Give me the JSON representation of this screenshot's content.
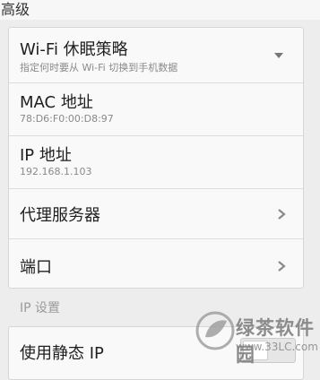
{
  "header": {
    "title": "高级"
  },
  "advanced": {
    "wifi_sleep": {
      "label": "Wi-Fi 休眠策略",
      "summary": "指定何时要从 Wi-Fi 切换到手机数据"
    },
    "mac": {
      "label": "MAC 地址",
      "value": "78:D6:F0:00:D8:97"
    },
    "ip": {
      "label": "IP 地址",
      "value": "192.168.1.103"
    },
    "proxy": {
      "label": "代理服务器"
    },
    "port": {
      "label": "端口"
    }
  },
  "ip_settings": {
    "section_title": "IP 设置",
    "static_ip": {
      "label": "使用静态 IP",
      "enabled": false
    }
  },
  "watermark": {
    "text": "绿茶软件园",
    "url": "www.33LC.com"
  },
  "icons": {
    "dropdown": "chevron-down-icon",
    "proxy_chevron": "chevron-right-icon",
    "port_chevron": "chevron-right-icon",
    "watermark_logo": "leaf-logo-icon"
  }
}
